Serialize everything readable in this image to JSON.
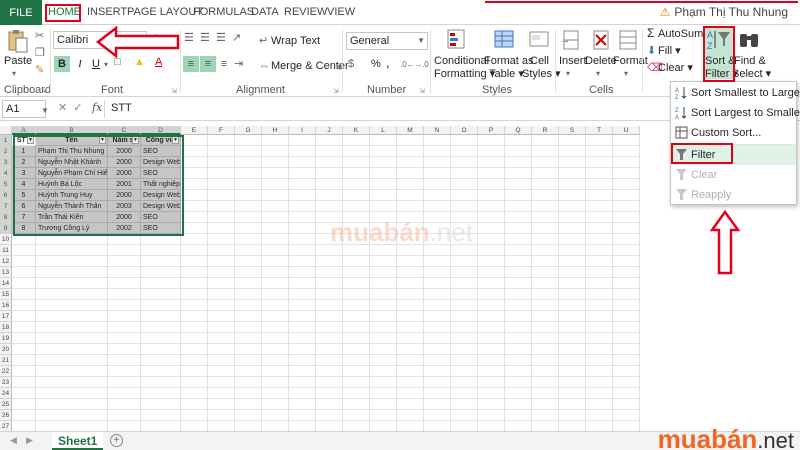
{
  "tabs": {
    "file": "FILE",
    "items": [
      "HOME",
      "INSERT",
      "PAGE LAYOUT",
      "FORMULAS",
      "DATA",
      "REVIEW",
      "VIEW"
    ],
    "active": "HOME",
    "user": "Phạm Thị Thu Nhung"
  },
  "ribbon": {
    "clipboard": {
      "paste": "Paste",
      "label": "Clipboard"
    },
    "font": {
      "name": "Calibri",
      "size": "14",
      "bold": "B",
      "italic": "I",
      "underline": "U",
      "label": "Font",
      "grow": "A",
      "shrink": "A"
    },
    "alignment": {
      "wrap": "Wrap Text",
      "merge": "Merge & Center",
      "label": "Alignment"
    },
    "number": {
      "format": "General",
      "currency": "$",
      "percent": "%",
      "comma": ",",
      "label": "Number"
    },
    "styles": {
      "conditional_1": "Conditional",
      "conditional_2": "Formatting",
      "table_1": "Format as",
      "table_2": "Table",
      "cell_1": "Cell",
      "cell_2": "Styles",
      "label": "Styles"
    },
    "cells": {
      "insert": "Insert",
      "delete": "Delete",
      "format": "Format",
      "label": "Cells"
    },
    "editing": {
      "autosum": "AutoSum",
      "fill": "Fill",
      "clear": "Clear",
      "sort_1": "Sort &",
      "sort_2": "Filter",
      "find_1": "Find &",
      "find_2": "Select"
    }
  },
  "formula_bar": {
    "name_box": "A1",
    "fx": "fx",
    "content": "STT"
  },
  "columns": [
    "A",
    "B",
    "C",
    "D",
    "E",
    "F",
    "G",
    "H",
    "I",
    "J",
    "K",
    "L",
    "M",
    "N",
    "O",
    "P",
    "Q",
    "R",
    "S",
    "T",
    "U"
  ],
  "table": {
    "headers": [
      "STT",
      "Tên",
      "Năm si",
      "Công việ"
    ],
    "rows": [
      [
        "1",
        "Phạm Thị Thu Nhung",
        "2000",
        "SEO"
      ],
      [
        "2",
        "Nguyễn Nhật Khánh",
        "2000",
        "Design Web"
      ],
      [
        "3",
        "Nguyễn Phạm Chí Hiếu",
        "2000",
        "SEO"
      ],
      [
        "4",
        "Huỳnh Bá Lộc",
        "2001",
        "Thất nghiệp"
      ],
      [
        "5",
        "Huỳnh Trung Huy",
        "2000",
        "Design Web"
      ],
      [
        "6",
        "Nguyễn Thành Thân",
        "2003",
        "Design Web"
      ],
      [
        "7",
        "Trần Thái Kiên",
        "2000",
        "SEO"
      ],
      [
        "8",
        "Trương Công Lý",
        "2002",
        "SEO"
      ]
    ]
  },
  "row_count": 27,
  "sort_menu": {
    "items": [
      {
        "label": "Sort Smallest to Largest",
        "enabled": true
      },
      {
        "label": "Sort Largest to Smallest",
        "enabled": true
      },
      {
        "label": "Custom Sort...",
        "enabled": true
      },
      {
        "label": "Filter",
        "enabled": true
      },
      {
        "label": "Clear",
        "enabled": false
      },
      {
        "label": "Reapply",
        "enabled": false
      }
    ]
  },
  "sheet": {
    "name": "Sheet1",
    "add": "+"
  },
  "watermark": {
    "text_a": "muabán",
    "text_b": ".net"
  },
  "brand_logo": {
    "text_a": "muabán",
    "text_b": ".net"
  },
  "colors": {
    "excel_green": "#217346",
    "annotation_red": "#e0001b",
    "brand_orange": "#f26522"
  }
}
